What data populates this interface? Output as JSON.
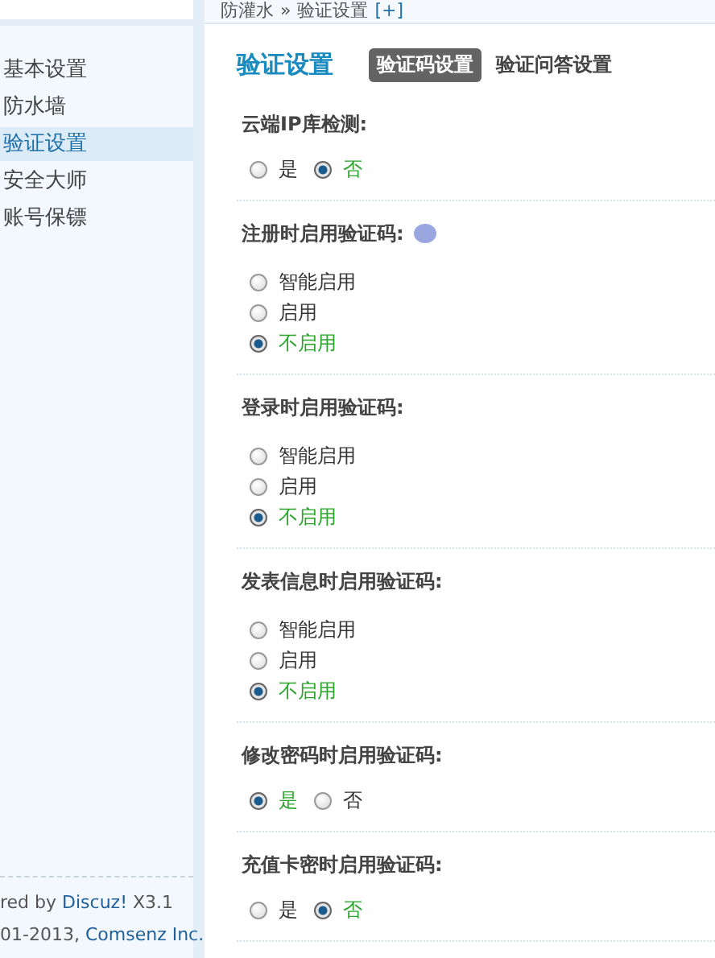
{
  "breadcrumb": {
    "items": [
      "防灌水",
      "验证设置"
    ],
    "separator": "»",
    "add": "[+]"
  },
  "sidebar": {
    "items": [
      {
        "label": "基本设置",
        "selected": false
      },
      {
        "label": "防水墙",
        "selected": false
      },
      {
        "label": "验证设置",
        "selected": true
      },
      {
        "label": "安全大师",
        "selected": false
      },
      {
        "label": "账号保镖",
        "selected": false
      }
    ],
    "footer": [
      {
        "text": "red by ",
        "link": "Discuz!",
        "after": " X3.1"
      },
      {
        "text": "01-2013, ",
        "link": "Comsenz Inc."
      }
    ]
  },
  "page_title": "验证设置",
  "tabs": [
    {
      "label": "验证码设置",
      "selected": true
    },
    {
      "label": "验证问答设置",
      "selected": false
    }
  ],
  "settings": [
    {
      "label": "云端IP库检测:",
      "kind": "inline",
      "options": [
        {
          "label": "是",
          "selected": false
        },
        {
          "label": "否",
          "selected": true
        }
      ]
    },
    {
      "label": "注册时启用验证码:",
      "help": true,
      "kind": "stacked",
      "options": [
        {
          "label": "智能启用",
          "selected": false
        },
        {
          "label": "启用",
          "selected": false
        },
        {
          "label": "不启用",
          "selected": true
        }
      ]
    },
    {
      "label": "登录时启用验证码:",
      "kind": "stacked",
      "options": [
        {
          "label": "智能启用",
          "selected": false
        },
        {
          "label": "启用",
          "selected": false
        },
        {
          "label": "不启用",
          "selected": true
        }
      ]
    },
    {
      "label": "发表信息时启用验证码:",
      "kind": "stacked",
      "options": [
        {
          "label": "智能启用",
          "selected": false
        },
        {
          "label": "启用",
          "selected": false
        },
        {
          "label": "不启用",
          "selected": true
        }
      ]
    },
    {
      "label": "修改密码时启用验证码:",
      "kind": "inline",
      "options": [
        {
          "label": "是",
          "selected": true
        },
        {
          "label": "否",
          "selected": false
        }
      ]
    },
    {
      "label": "充值卡密时启用验证码:",
      "kind": "inline",
      "options": [
        {
          "label": "是",
          "selected": false
        },
        {
          "label": "否",
          "selected": true
        }
      ]
    }
  ]
}
